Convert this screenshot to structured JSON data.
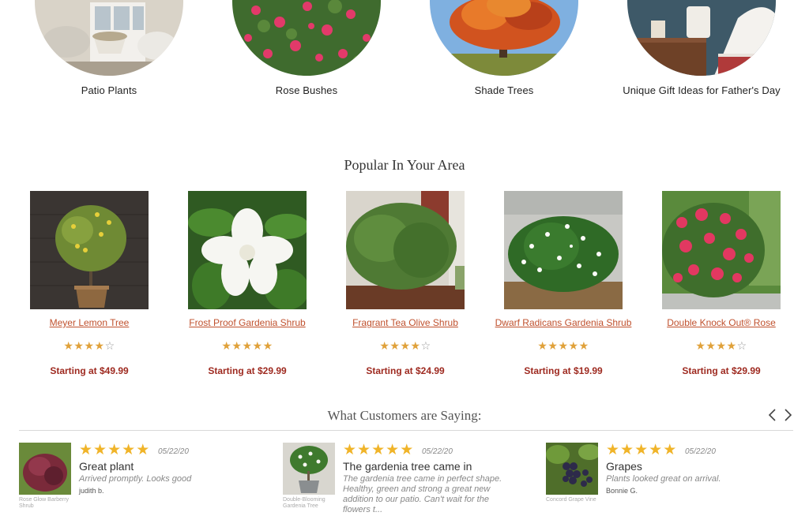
{
  "categories": [
    {
      "label": "Patio Plants"
    },
    {
      "label": "Rose Bushes"
    },
    {
      "label": "Shade Trees"
    },
    {
      "label": "Unique Gift Ideas for Father's Day"
    }
  ],
  "popular": {
    "title": "Popular In Your Area",
    "products": [
      {
        "name": "Meyer Lemon Tree",
        "rating": 4,
        "rating_max": 5,
        "price": "Starting at $49.99"
      },
      {
        "name": "Frost Proof Gardenia Shrub",
        "rating": 5,
        "rating_max": 5,
        "price": "Starting at $29.99"
      },
      {
        "name": "Fragrant Tea Olive Shrub",
        "rating": 4,
        "rating_max": 5,
        "price": "Starting at $24.99"
      },
      {
        "name": "Dwarf Radicans Gardenia Shrub",
        "rating": 5,
        "rating_max": 5,
        "price": "Starting at $19.99"
      },
      {
        "name": "Double Knock Out® Rose",
        "rating": 4,
        "rating_max": 5,
        "price": "Starting at $29.99"
      }
    ]
  },
  "reviews": {
    "title": "What Customers are Saying:",
    "items": [
      {
        "plant": "Rose Glow Barberry Shrub",
        "rating": 5,
        "date": "05/22/20",
        "title": "Great plant",
        "body": "Arrived promptly. Looks good",
        "author": "judith b."
      },
      {
        "plant": "Double-Blooming Gardenia Tree",
        "rating": 5,
        "date": "05/22/20",
        "title": "The gardenia tree came in",
        "body": "The gardenia tree came in perfect shape. Healthy, green and strong a great new addition to our patio. Can't wait for the flowers t...",
        "author": ""
      },
      {
        "plant": "Concord Grape Vine",
        "rating": 5,
        "date": "05/22/20",
        "title": "Grapes",
        "body": "Plants looked great on arrival.",
        "author": "Bonnie G."
      }
    ]
  },
  "colors": {
    "product_link": "#c0512e",
    "price": "#9e2a20",
    "star_product": "#e0a13a",
    "star_review": "#f0b429"
  },
  "icons": {
    "prev": "chevron-left-icon",
    "next": "chevron-right-icon"
  }
}
